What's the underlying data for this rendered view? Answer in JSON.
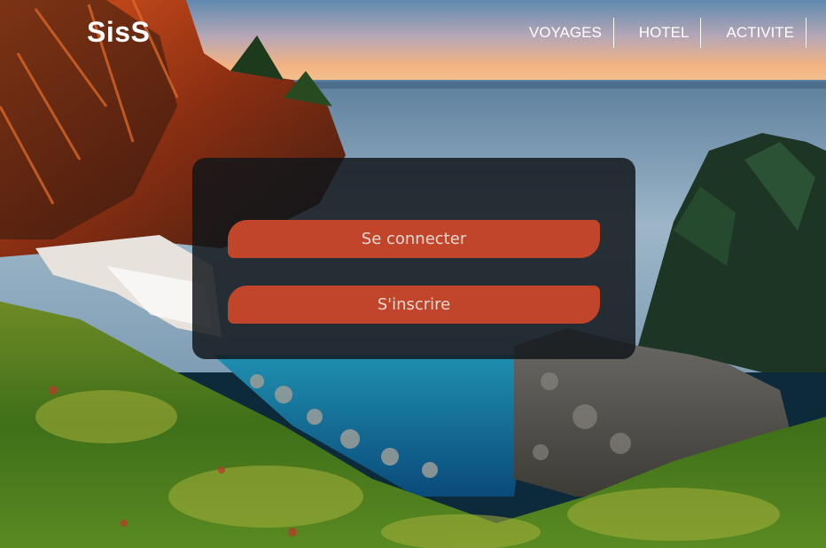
{
  "header": {
    "logo": "SisS",
    "nav": [
      {
        "label": "VOYAGES"
      },
      {
        "label": "HOTEL"
      },
      {
        "label": "ACTIVITE"
      }
    ]
  },
  "auth_panel": {
    "login_label": "Se connecter",
    "signup_label": "S'inscrire"
  },
  "colors": {
    "button": "#c0452a",
    "panel": "#11161a",
    "nav_text": "#ffffff"
  }
}
